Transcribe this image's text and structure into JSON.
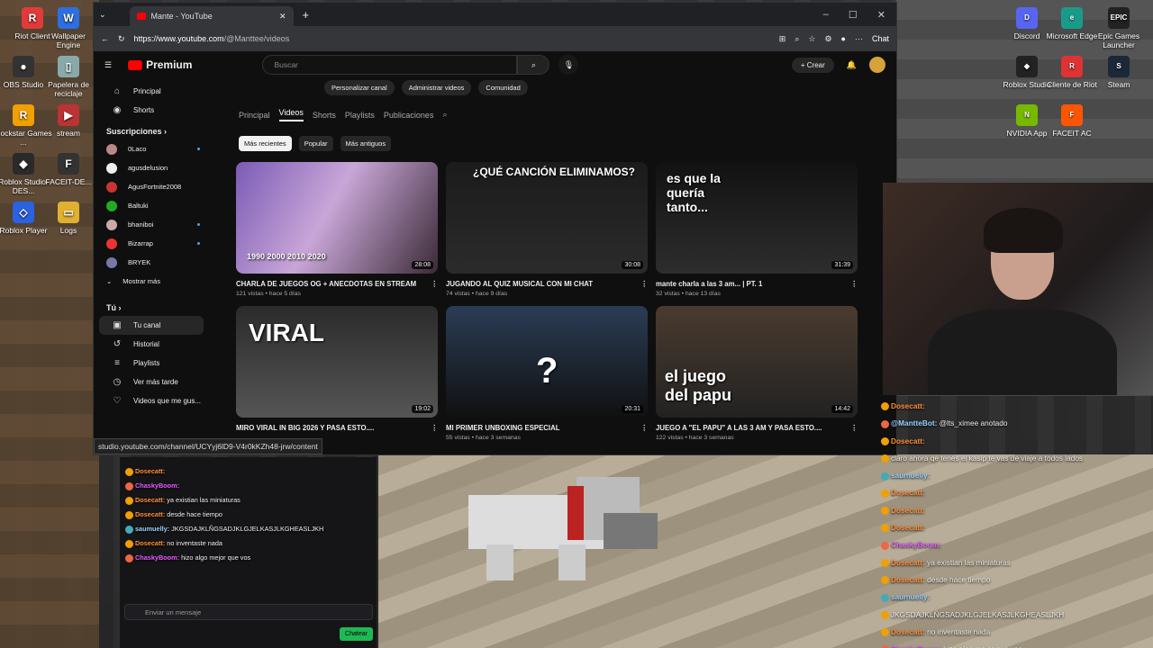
{
  "desktop_left": [
    {
      "label": "Riot Client",
      "color": "#e03a3a",
      "glyph": "R"
    },
    {
      "label": "Wallpaper Engine",
      "color": "#2b6fe0",
      "glyph": "W"
    },
    {
      "label": "OBS Studio",
      "color": "#333",
      "glyph": "●"
    },
    {
      "label": "Papelera de reciclaje",
      "color": "#8aa",
      "glyph": "▯"
    },
    {
      "label": "Rockstar Games ...",
      "color": "#f0a000",
      "glyph": "R"
    },
    {
      "label": "stream",
      "color": "#b33",
      "glyph": "▶"
    },
    {
      "label": "Roblox Studio-DES...",
      "color": "#2a2a2a",
      "glyph": "◆"
    },
    {
      "label": "FACEIT-DE...",
      "color": "#333",
      "glyph": "F"
    },
    {
      "label": "Roblox Player",
      "color": "#2a62e0",
      "glyph": "◇"
    },
    {
      "label": "Logs",
      "color": "#e0b030",
      "glyph": "▭"
    }
  ],
  "desktop_right": [
    {
      "label": "Discord",
      "color": "#5865f2",
      "glyph": "D"
    },
    {
      "label": "Microsoft Edge",
      "color": "#1a9b8a",
      "glyph": "e"
    },
    {
      "label": "Epic Games Launcher",
      "color": "#222",
      "glyph": "EPIC"
    },
    {
      "label": "Roblox Studio",
      "color": "#222",
      "glyph": "◆"
    },
    {
      "label": "Cliente de Riot",
      "color": "#d33",
      "glyph": "R"
    },
    {
      "label": "Steam",
      "color": "#1b2838",
      "glyph": "S"
    },
    {
      "label": "NVIDIA App",
      "color": "#76b900",
      "glyph": "N"
    },
    {
      "label": "FACEIT AC",
      "color": "#ff5500",
      "glyph": "F"
    }
  ],
  "browser": {
    "tab_title": "Mante - YouTube",
    "url_domain": "https://www.youtube.com",
    "url_path": "/@Manttee/videos",
    "chat_label": "Chat",
    "status_url": "studio.youtube.com/channel/UCYyj6lD9-V4r0kKZh48-jrw/content"
  },
  "youtube": {
    "logo": "Premium",
    "search_placeholder": "Buscar",
    "create_label": "Crear",
    "nav": [
      {
        "label": "Principal",
        "icon": "⌂"
      },
      {
        "label": "Shorts",
        "icon": "◉"
      }
    ],
    "subs_heading": "Suscripciones",
    "subs": [
      {
        "name": "0Laco",
        "color": "#b88",
        "live": true
      },
      {
        "name": "agusdelusion",
        "color": "#eee",
        "live": false
      },
      {
        "name": "AgusFortnite2008",
        "color": "#c33",
        "live": false
      },
      {
        "name": "Baltuki",
        "color": "#2a2",
        "live": false
      },
      {
        "name": "bhaniboi",
        "color": "#caa",
        "live": true
      },
      {
        "name": "Bizarrap",
        "color": "#e33",
        "live": true
      },
      {
        "name": "BRYEK",
        "color": "#77a",
        "live": false
      }
    ],
    "show_more": "Mostrar más",
    "you_heading": "Tú",
    "you_items": [
      {
        "label": "Tu canal",
        "icon": "▣",
        "active": true
      },
      {
        "label": "Historial",
        "icon": "↺",
        "active": false
      },
      {
        "label": "Playlists",
        "icon": "≡",
        "active": false
      },
      {
        "label": "Ver más tarde",
        "icon": "◷",
        "active": false
      },
      {
        "label": "Videos que me gus...",
        "icon": "♡",
        "active": false
      }
    ],
    "channel_buttons": [
      "Personalizar canal",
      "Administrar videos",
      "Comunidad"
    ],
    "channel_tabs": [
      "Principal",
      "Videos",
      "Shorts",
      "Playlists",
      "Publicaciones"
    ],
    "active_tab": "Videos",
    "chips": [
      "Más recientes",
      "Popular",
      "Más antiguos"
    ],
    "videos": [
      {
        "title": "CHARLA DE JUEGOS OG + ANECDOTAS EN STREAM",
        "meta": "121 vistas • hace 5 días",
        "duration": "28:08",
        "bg": "linear-gradient(120deg,#7a5bb5,#c9a6d8 45%,#3a2a35)",
        "caption": "1990   2000   2010   2020"
      },
      {
        "title": "JUGANDO AL QUIZ MUSICAL CON MI CHAT",
        "meta": "74 vistas • hace 9 días",
        "duration": "30:08",
        "bg": "linear-gradient(180deg,#1b1b1b,#2b2b2b)",
        "caption": "¿QUÉ CANCIÓN ELIMINAMOS?"
      },
      {
        "title": "mante charla a las 3 am... | PT. 1",
        "meta": "32 vistas • hace 13 días",
        "duration": "31:39",
        "bg": "linear-gradient(180deg,#121212,#2d2d2d)",
        "caption": "es que la quería tanto..."
      },
      {
        "title": "MIRO VIRAL IN BIG 2026 Y PASA ESTO....",
        "meta": "",
        "duration": "19:02",
        "bg": "linear-gradient(180deg,#2b2b2b,#555)",
        "caption": "VIRAL"
      },
      {
        "title": "MI PRIMER UNBOXING ESPECIAL",
        "meta": "55 vistas • hace 3 semanas",
        "duration": "20:31",
        "bg": "linear-gradient(180deg,#2a3c55,#101010)",
        "caption": "?"
      },
      {
        "title": "JUEGO A \"EL PAPU\" A LAS 3 AM Y PASA ESTO....",
        "meta": "122 vistas • hace 3 semanas",
        "duration": "14:42",
        "bg": "linear-gradient(180deg,#4a3b2f,#222)",
        "caption": "el juego del papu"
      }
    ]
  },
  "right_chat": [
    {
      "name": "Dosecatt:",
      "nc": "n1",
      "text": ""
    },
    {
      "name": "@MantteBot:",
      "nc": "n3",
      "text": "@lts_ximee anotado"
    },
    {
      "name": "Dosecatt:",
      "nc": "n1",
      "text": ""
    },
    {
      "name": "",
      "nc": "n1",
      "text": "claro ahora qe tenés el kasip te vas de viaje a todos lados"
    },
    {
      "name": "saumuelly:",
      "nc": "n3",
      "text": ""
    },
    {
      "name": "Dosecatt:",
      "nc": "n1",
      "text": ""
    },
    {
      "name": "Dosecatt:",
      "nc": "n1",
      "text": ""
    },
    {
      "name": "Dosecatt:",
      "nc": "n1",
      "text": ""
    },
    {
      "name": "ChaskyBoom:",
      "nc": "n2",
      "text": ""
    },
    {
      "name": "Dosecatt:",
      "nc": "n1",
      "text": "ya existian las miniaturas"
    },
    {
      "name": "Dosecatt:",
      "nc": "n1",
      "text": "desde hace tiempo"
    },
    {
      "name": "saumuelly:",
      "nc": "n3",
      "text": ""
    },
    {
      "name": "",
      "nc": "n3",
      "text": "JKGSDAJKLÑGSADJKLGJELKASJLKGHEASLJKH"
    },
    {
      "name": "Dosecatt:",
      "nc": "n1",
      "text": "no inventaste nada"
    },
    {
      "name": "ChaskyBoom:",
      "nc": "n2",
      "text": "hizo algo mejor que vos"
    }
  ],
  "left_chat": [
    {
      "name": "Dosecatt:",
      "nc": "n1",
      "text": ""
    },
    {
      "name": "ChaskyBoom:",
      "nc": "n2",
      "text": ""
    },
    {
      "name": "Dosecatt:",
      "nc": "n1",
      "text": "ya existian las miniaturas"
    },
    {
      "name": "Dosecatt:",
      "nc": "n1",
      "text": "desde hace tiempo"
    },
    {
      "name": "saumuelly:",
      "nc": "n3",
      "text": "JKGSDAJKLÑGSADJKLGJELKASJLKGHEASLJKH"
    },
    {
      "name": "Dosecatt:",
      "nc": "n1",
      "text": "no inventaste nada"
    },
    {
      "name": "ChaskyBoom:",
      "nc": "n2",
      "text": "hizo algo mejor que vos"
    }
  ],
  "chat_input_placeholder": "Enviar un mensaje",
  "chatear_label": "Chatear"
}
